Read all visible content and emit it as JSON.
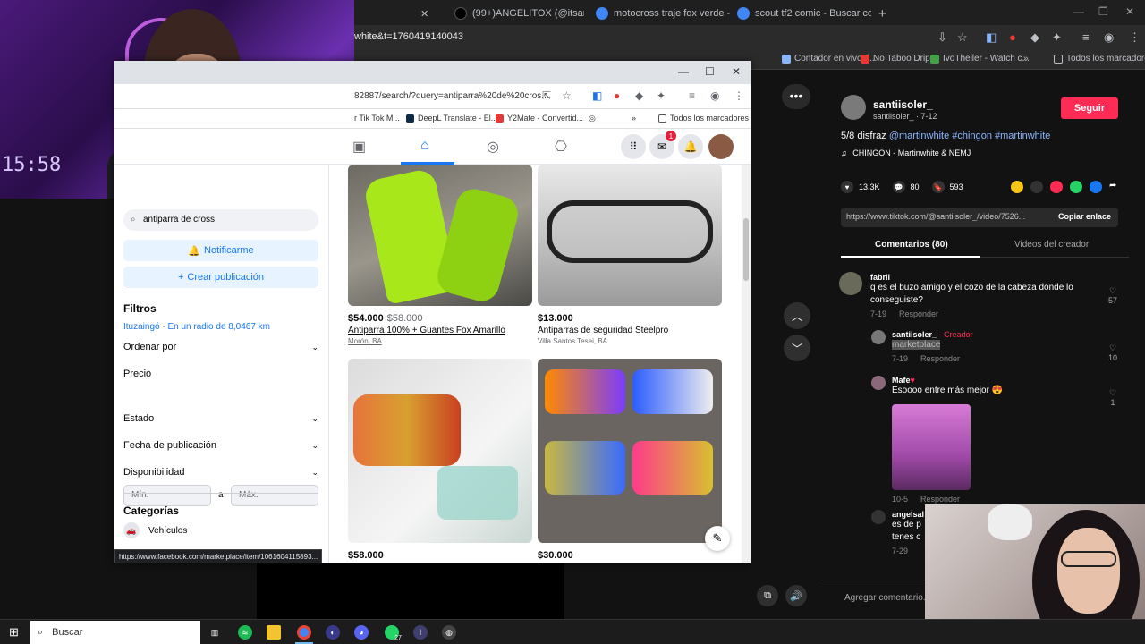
{
  "outer_tabs": [
    {
      "label": "(99+)ANGELITOX (@itsangelito",
      "x": ""
    },
    {
      "label": "motocross traje fox verde - Bus",
      "x": ""
    },
    {
      "label": "scout tf2 comic - Buscar con G",
      "x": ""
    }
  ],
  "outer_url": "white&t=1760419140043",
  "outer_bookmarks": [
    "Contador en vivo d...",
    "No Taboo Drip",
    "IvoTheiler - Watch c...",
    "Todos los marcadores"
  ],
  "webcam_clock": "15:58",
  "inner_url": "82887/search/?query=antiparra%20de%20cros...",
  "inner_bookmarks": [
    "r Tik Tok M...",
    "DeepL Translate - El...",
    "Y2Mate - Convertid...",
    "Todos los marcadores"
  ],
  "fb_nav": {
    "notification_count": "1"
  },
  "sidebar": {
    "search_value": "antiparra de cross",
    "notify_button": "Notificarme",
    "create_button": "Crear publicación",
    "filters_heading": "Filtros",
    "location": "Ituzaingó · En un radio de 8,0467 km",
    "sort_label": "Ordenar por",
    "price_label": "Precio",
    "min_placeholder": "Mín.",
    "to_label": "a",
    "max_placeholder": "Máx.",
    "state_label": "Estado",
    "date_label": "Fecha de publicación",
    "availability_label": "Disponibilidad",
    "categories_heading": "Categorías",
    "category_vehicles": "Vehículos"
  },
  "listings": [
    {
      "price": "$54.000",
      "old_price": "$58.000",
      "title": "Antiparra 100% + Guantes Fox Amarillo",
      "location": "Morón, BA"
    },
    {
      "price": "$13.000",
      "old_price": "",
      "title": "Antiparras de seguridad Steelpro",
      "location": "Villa Santos Tesei, BA"
    },
    {
      "price": "$58.000",
      "old_price": "",
      "title": "",
      "location": ""
    },
    {
      "price": "$30.000",
      "old_price": "",
      "title": "",
      "location": ""
    }
  ],
  "status_url": "https://www.facebook.com/marketplace/item/1061604115893...",
  "tiktok": {
    "username": "santiisoler_",
    "sub": "santiisoler_ · 7-12",
    "follow": "Seguir",
    "desc_prefix": "5/8 disfraz",
    "tags": [
      "@martinwhite",
      "#chingon",
      "#martinwhite"
    ],
    "music": "CHINGON - Martinwhite & NEMJ",
    "likes": "13.3K",
    "comments_count": "80",
    "saves": "593",
    "link": "https://www.tiktok.com/@santiisoler_/video/7526...",
    "copy_link": "Copiar enlace",
    "tab_comments": "Comentarios (80)",
    "tab_videos": "Videos del creador",
    "comments": [
      {
        "name": "fabrii",
        "text": "q es el buzo amigo y el cozo de la cabeza donde lo conseguiste?",
        "date": "7-19",
        "reply": "Responder",
        "likes": "57"
      },
      {
        "name": "santiisoler_",
        "creator": "· Creador",
        "text": "marketplace",
        "date": "7-19",
        "reply": "Responder",
        "likes": "10"
      },
      {
        "name": "Mafe",
        "text": "Esoooo entre más mejor 😍",
        "date": "10-5",
        "reply": "Responder",
        "likes": "1"
      },
      {
        "name": "angelsal",
        "text": "es de p",
        "text2": "tenes c",
        "date": "7-29",
        "reply": "",
        "likes": ""
      }
    ],
    "add_comment": "Agregar comentario..."
  },
  "taskbar": {
    "search": "Buscar",
    "whatsapp_badge": "27"
  }
}
